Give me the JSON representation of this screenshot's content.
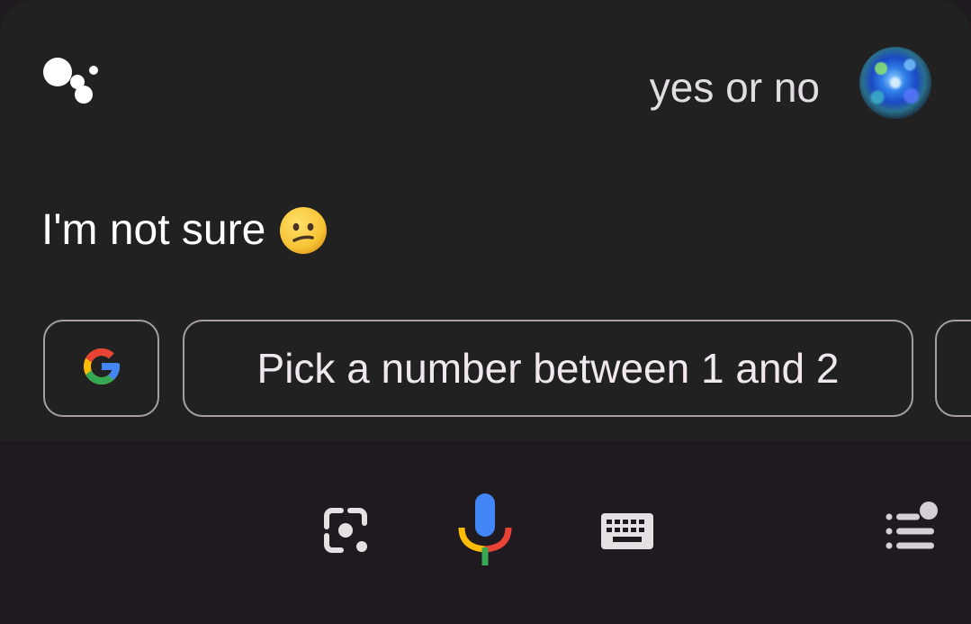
{
  "header": {
    "logo_icon": "google-assistant-logo-icon",
    "query_text": "yes or no",
    "avatar_icon": "user-avatar-icon"
  },
  "response": {
    "text": "I'm not sure",
    "emoji_icon": "confused-face-emoji-icon"
  },
  "suggestions": {
    "google_chip_icon": "google-g-icon",
    "chip_label": "Pick a number between 1 and 2"
  },
  "bottom_bar": {
    "lens_icon": "google-lens-icon",
    "mic_icon": "microphone-icon",
    "keyboard_icon": "keyboard-icon",
    "routine_icon": "assistant-routines-icon"
  },
  "colors": {
    "panel_background": "#212121",
    "bottom_background": "#1f1a1f",
    "query_text": "#e2dde2",
    "response_text": "#ffffff",
    "chip_border": "#a79ea5",
    "google_blue": "#4285f4",
    "google_red": "#ea4335",
    "google_yellow": "#fbbc05",
    "google_green": "#34a853"
  }
}
